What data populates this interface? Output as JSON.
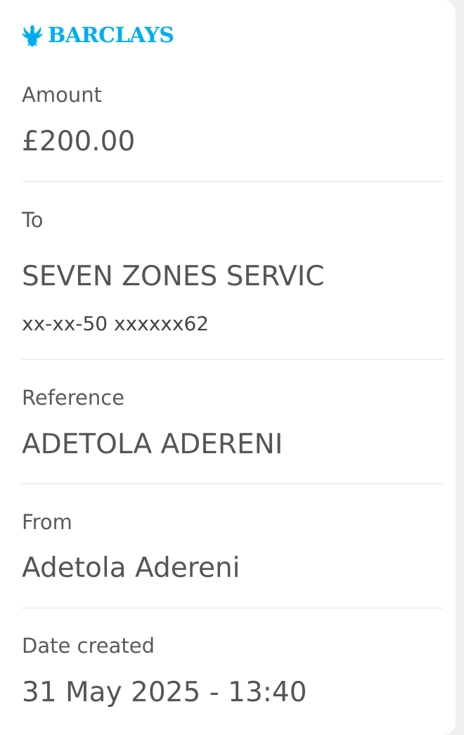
{
  "brand": {
    "name": "BARCLAYS",
    "icon": "eagle-icon",
    "color": "#00aeef"
  },
  "details": {
    "amount": {
      "label": "Amount",
      "value": "£200.00"
    },
    "to": {
      "label": "To",
      "name": "SEVEN ZONES SERVIC",
      "account": "xx-xx-50 xxxxxx62"
    },
    "reference": {
      "label": "Reference",
      "value": "ADETOLA ADERENI"
    },
    "from": {
      "label": "From",
      "value": "Adetola Adereni"
    },
    "date_created": {
      "label": "Date created",
      "value": "31 May 2025 - 13:40"
    }
  }
}
